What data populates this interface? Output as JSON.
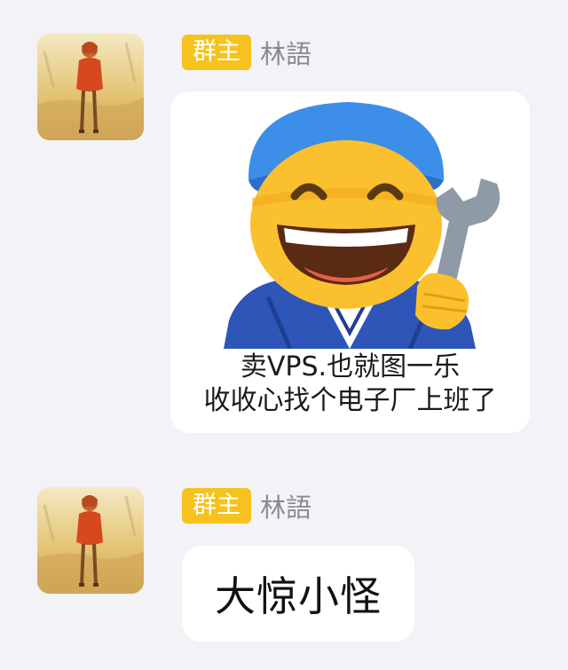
{
  "messages": [
    {
      "sender": {
        "role_badge": "群主",
        "name": "林語"
      },
      "avatar_icon": "anime-girl-avatar-icon",
      "type": "image",
      "image": {
        "icon": "mechanic-emoji-with-wrench-icon",
        "caption_line1": "卖VPS.也就图一乐",
        "caption_line2": "收收心找个电子厂上班了"
      }
    },
    {
      "sender": {
        "role_badge": "群主",
        "name": "林語"
      },
      "avatar_icon": "anime-girl-avatar-icon",
      "type": "text",
      "text": "大惊小怪"
    }
  ],
  "colors": {
    "background": "#f2f2f7",
    "bubble": "#ffffff",
    "role_badge": "#f7c21d",
    "sender_name": "#8a8a90"
  }
}
